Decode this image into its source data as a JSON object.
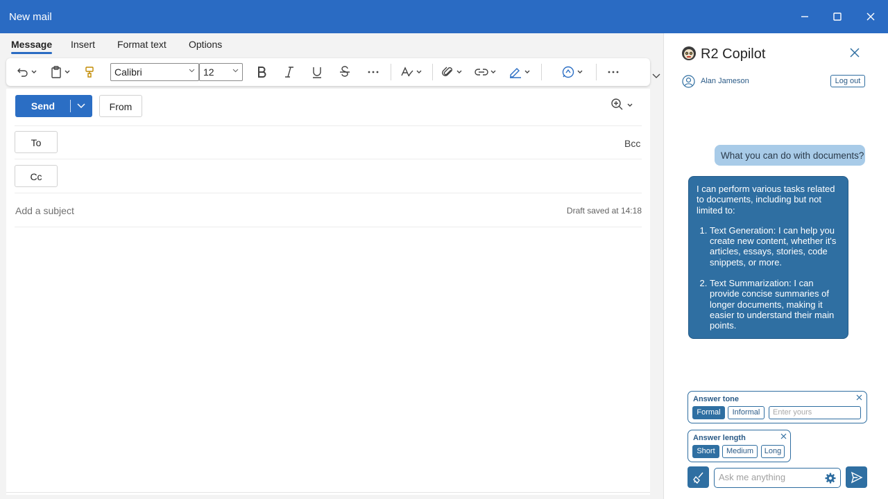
{
  "window": {
    "title": "New mail"
  },
  "tabs": [
    {
      "label": "Message",
      "active": true
    },
    {
      "label": "Insert"
    },
    {
      "label": "Format text"
    },
    {
      "label": "Options"
    }
  ],
  "ribbon": {
    "font_name": "Calibri",
    "font_size": "12"
  },
  "compose": {
    "send_label": "Send",
    "from_label": "From",
    "to_label": "To",
    "cc_label": "Cc",
    "bcc_label": "Bcc",
    "subject_placeholder": "Add a subject",
    "draft_status": "Draft saved at 14:18"
  },
  "copilot": {
    "title": "R2 Copilot",
    "user_name": "Alan Jameson",
    "logout_label": "Log out",
    "user_message": "What you can do with documents?",
    "bot_intro": "I can perform various tasks related to documents, including but not limited to:",
    "bot_items": [
      "Text Generation: I can help you create new content, whether it's articles, essays, stories, code snippets, or more.",
      "Text Summarization: I can provide concise summaries of longer documents, making it easier to understand their main points."
    ],
    "tone": {
      "label": "Answer tone",
      "options": [
        "Formal",
        "Informal"
      ],
      "selected": "Formal",
      "custom_placeholder": "Enter yours"
    },
    "length": {
      "label": "Answer length",
      "options": [
        "Short",
        "Medium",
        "Long"
      ],
      "selected": "Short"
    },
    "ask_placeholder": "Ask me anything"
  },
  "colors": {
    "titlebar": "#2a6bc3",
    "send": "#2b6ec4",
    "copilot_accent": "#2f6fa2",
    "user_bubble": "#a8cbe8"
  }
}
